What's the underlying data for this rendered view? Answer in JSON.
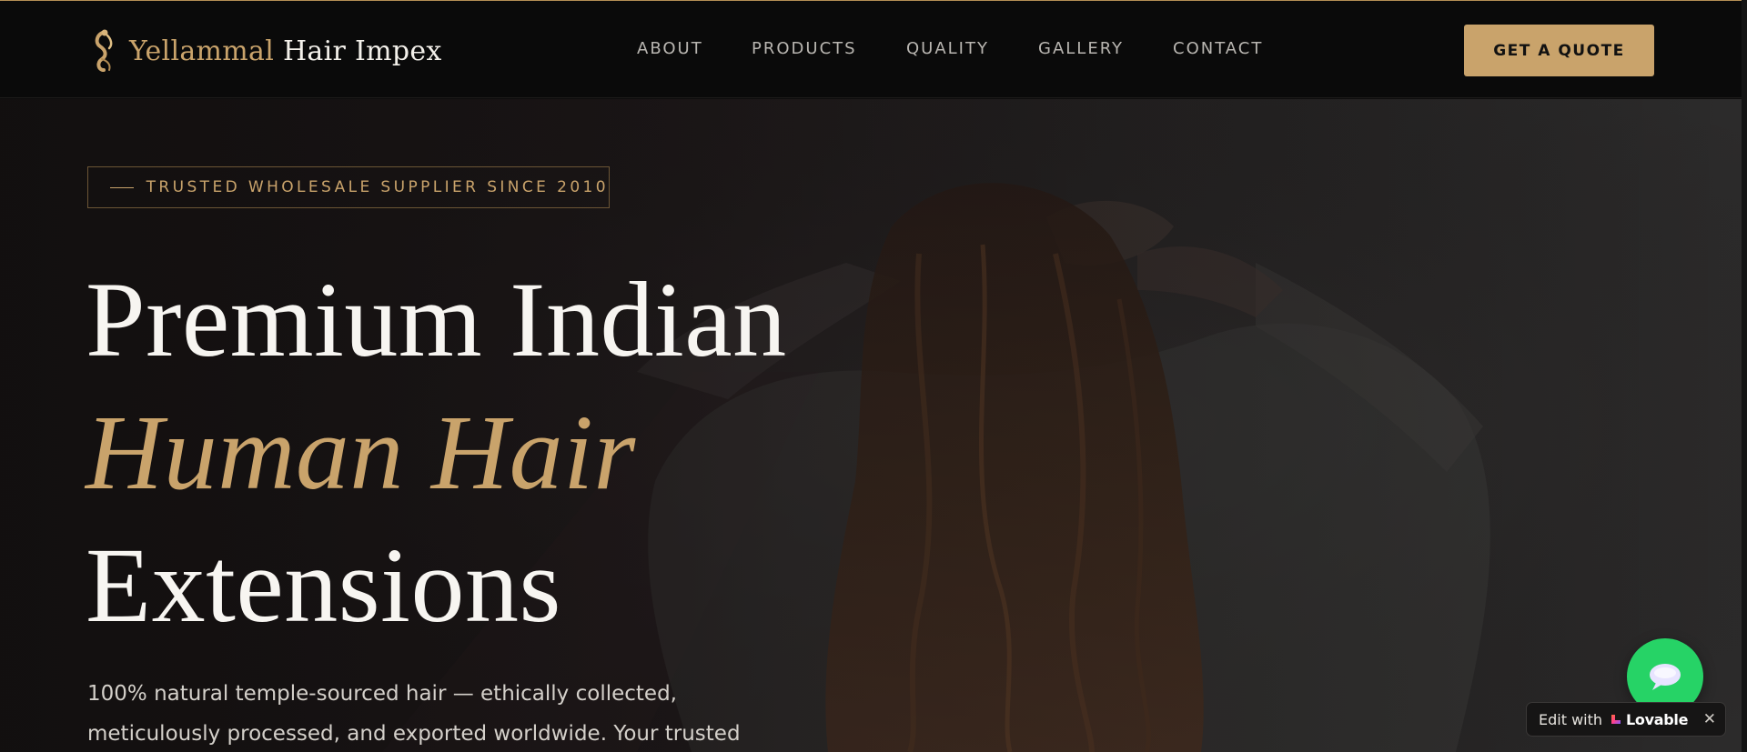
{
  "brand": {
    "name_part1": "Yellammal",
    "name_part2": "Hair Impex",
    "logo_icon": "hair-swirl-icon",
    "gold_color": "#c9a36b"
  },
  "nav": {
    "items": [
      {
        "label": "ABOUT"
      },
      {
        "label": "PRODUCTS"
      },
      {
        "label": "QUALITY"
      },
      {
        "label": "GALLERY"
      },
      {
        "label": "CONTACT"
      }
    ]
  },
  "header": {
    "cta_label": "GET A QUOTE"
  },
  "hero": {
    "eyebrow": "TRUSTED WHOLESALE SUPPLIER SINCE 2010",
    "headline_line1": "Premium Indian",
    "headline_line2": "Human Hair",
    "headline_line3": "Extensions",
    "lead_line1": "100% natural temple-sourced hair — ethically collected,",
    "lead_line2": "meticulously processed, and exported worldwide. Your trusted"
  },
  "floating": {
    "chat_icon": "chat-bubble-icon",
    "chat_color": "#26d366",
    "badge_edit": "Edit with",
    "badge_brand": "Lovable",
    "badge_close": "✕"
  }
}
